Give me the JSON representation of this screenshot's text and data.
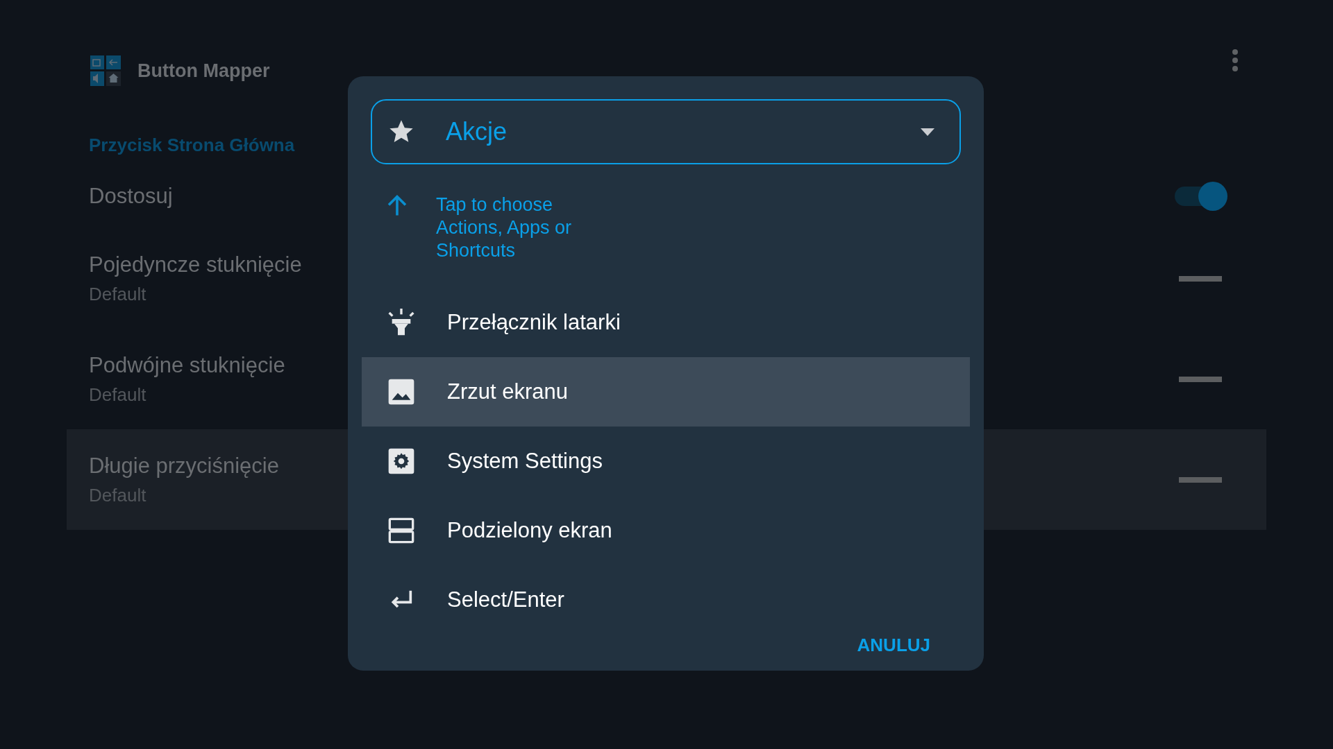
{
  "app_bar": {
    "title": "Button Mapper"
  },
  "section_title": "Przycisk Strona Główna",
  "settings": [
    {
      "kind": "switch",
      "title": "Dostosuj",
      "on": true
    },
    {
      "kind": "action",
      "title": "Pojedyncze stuknięcie",
      "value": "Default",
      "selected": false
    },
    {
      "kind": "action",
      "title": "Podwójne stuknięcie",
      "value": "Default",
      "selected": false
    },
    {
      "kind": "action",
      "title": "Długie przyciśnięcie",
      "value": "Default",
      "selected": true
    }
  ],
  "dialog": {
    "dropdown": {
      "value": "Akcje"
    },
    "hint": "Tap to choose Actions, Apps or Shortcuts",
    "items": [
      {
        "kind": "flashlight",
        "label": "Przełącznik latarki",
        "selected": false
      },
      {
        "kind": "image",
        "label": "Zrzut ekranu",
        "selected": true
      },
      {
        "kind": "gear",
        "label": "System Settings",
        "selected": false
      },
      {
        "kind": "split",
        "label": "Podzielony ekran",
        "selected": false
      },
      {
        "kind": "enter",
        "label": "Select/Enter",
        "selected": false
      }
    ],
    "buttons": [
      "ANULUJ"
    ]
  }
}
